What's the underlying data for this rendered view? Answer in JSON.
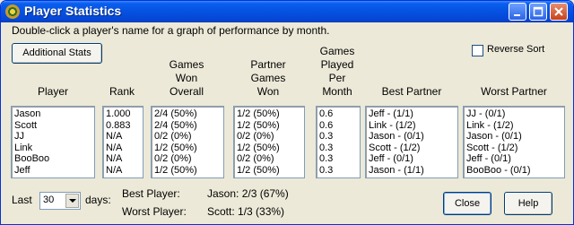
{
  "window": {
    "title": "Player Statistics",
    "icon": "dartboard-icon"
  },
  "instruction": "Double-click a player's name for a graph of performance by month.",
  "buttons": {
    "additional_stats": "Additional Stats",
    "close": "Close",
    "help": "Help"
  },
  "reverse_sort": {
    "label": "Reverse Sort",
    "checked": false
  },
  "columns": [
    {
      "header": "Player",
      "items": [
        "Jason",
        "Scott",
        "JJ",
        "Link",
        "BooBoo",
        "Jeff"
      ]
    },
    {
      "header": "Rank",
      "items": [
        "1.000",
        "0.883",
        "N/A",
        "N/A",
        "N/A",
        "N/A"
      ]
    },
    {
      "header": "Games\nWon\nOverall",
      "items": [
        "2/4 (50%)",
        "2/4 (50%)",
        "0/2 (0%)",
        "1/2 (50%)",
        "0/2 (0%)",
        "1/2 (50%)"
      ]
    },
    {
      "header": "Partner\nGames\nWon",
      "items": [
        "1/2 (50%)",
        "1/2 (50%)",
        "0/2 (0%)",
        "1/2 (50%)",
        "0/2 (0%)",
        "1/2 (50%)"
      ]
    },
    {
      "header": "Games\nPlayed\nPer\nMonth",
      "items": [
        "0.6",
        "0.6",
        "0.3",
        "0.3",
        "0.3",
        "0.3"
      ]
    },
    {
      "header": "Best Partner",
      "items": [
        "Jeff - (1/1)",
        "Link - (1/2)",
        "Jason - (0/1)",
        "Scott - (1/2)",
        "Jeff - (0/1)",
        "Jason - (1/1)"
      ]
    },
    {
      "header": "Worst Partner",
      "items": [
        "JJ - (0/1)",
        "Link - (1/2)",
        "Jason - (0/1)",
        "Scott - (1/2)",
        "Jeff - (0/1)",
        "BooBoo - (0/1)"
      ]
    }
  ],
  "period": {
    "last_label": "Last",
    "value": "30",
    "days_label": "days:"
  },
  "summary": {
    "best_label": "Best Player:",
    "best_value": "Jason: 2/3 (67%)",
    "worst_label": "Worst Player:",
    "worst_value": "Scott: 1/3 (33%)"
  },
  "colors": {
    "title_bar": "#0653E3",
    "window_bg": "#ECE9D8",
    "close_button": "#C8421C"
  }
}
